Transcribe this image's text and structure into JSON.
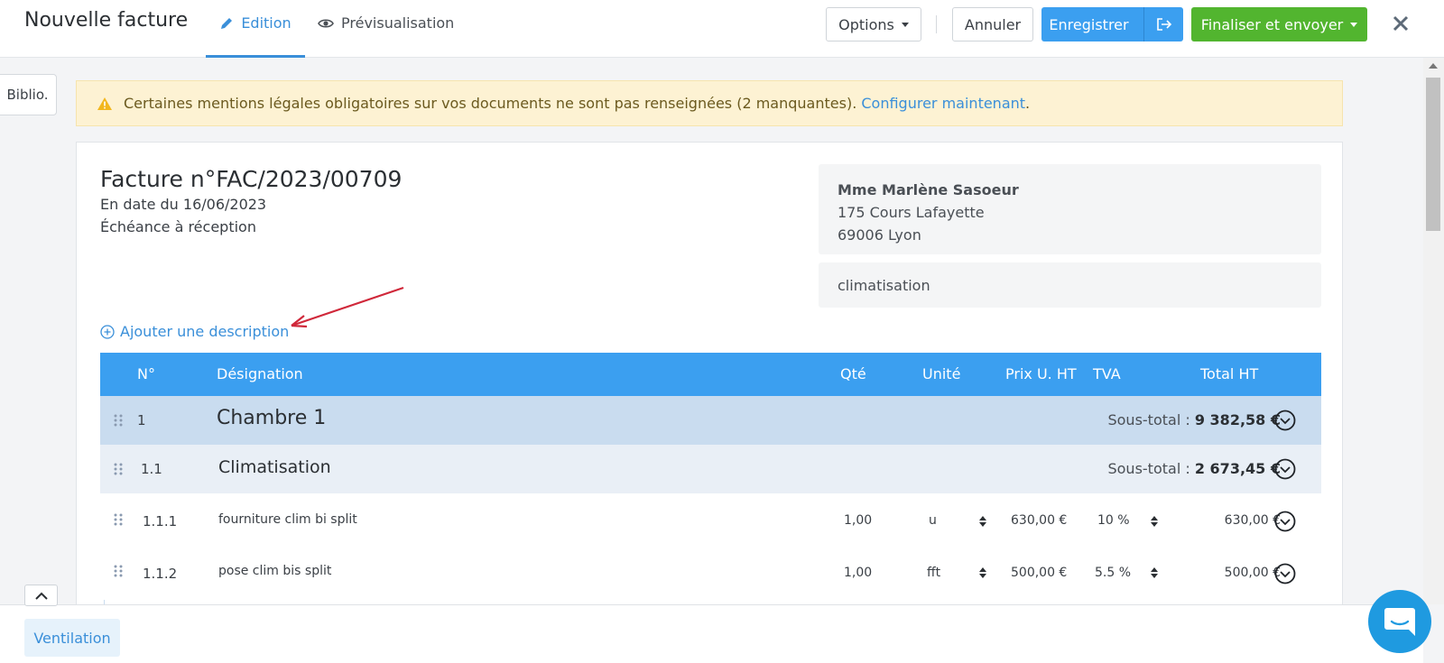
{
  "header": {
    "title": "Nouvelle facture",
    "tabs": [
      {
        "label": "Edition",
        "icon": "pencil-icon",
        "active": true
      },
      {
        "label": "Prévisualisation",
        "icon": "eye-icon",
        "active": false
      }
    ],
    "options_label": "Options",
    "cancel_label": "Annuler",
    "save_label": "Enregistrer",
    "finalize_label": "Finaliser et envoyer"
  },
  "sidebar": {
    "biblio_label": "Biblio."
  },
  "warning": {
    "text": "Certaines mentions légales obligatoires sur vos documents ne sont pas renseignées (2 manquantes).",
    "link": "Configurer maintenant",
    "suffix": "."
  },
  "invoice": {
    "title": "Facture n°FAC/2023/00709",
    "date": "En date du 16/06/2023",
    "due": "Échéance à réception",
    "client": {
      "name": "Mme Marlène Sasoeur",
      "street": "175 Cours Lafayette",
      "city": "69006 Lyon"
    },
    "object": "climatisation",
    "add_description": "Ajouter une description"
  },
  "table": {
    "headers": {
      "num": "N°",
      "designation": "Désignation",
      "qty": "Qté",
      "unit": "Unité",
      "price": "Prix U. HT",
      "vat": "TVA",
      "total": "Total HT"
    },
    "subtotal_label": "Sous-total :",
    "sections": [
      {
        "num": "1",
        "title": "Chambre 1",
        "subtotal": "9 382,58 €"
      },
      {
        "num": "1.1",
        "title": "Climatisation",
        "subtotal": "2 673,45 €"
      }
    ],
    "lines": [
      {
        "num": "1.1.1",
        "designation": "fourniture clim bi split",
        "qty": "1,00",
        "unit": "u",
        "price": "630,00 €",
        "vat": "10 %",
        "total": "630,00 €"
      },
      {
        "num": "1.1.2",
        "designation": "pose clim bis split",
        "qty": "1,00",
        "unit": "fft",
        "price": "500,00 €",
        "vat": "5.5 %",
        "total": "500,00 €"
      }
    ]
  },
  "footer": {
    "ventilation_label": "Ventilation"
  },
  "colors": {
    "primary": "#3b9ff0",
    "success": "#52b52f",
    "warning_bg": "#fdf2d3",
    "section_l1": "#c9dcef",
    "section_l2": "#e9eff6",
    "arrow": "#d0283a"
  }
}
